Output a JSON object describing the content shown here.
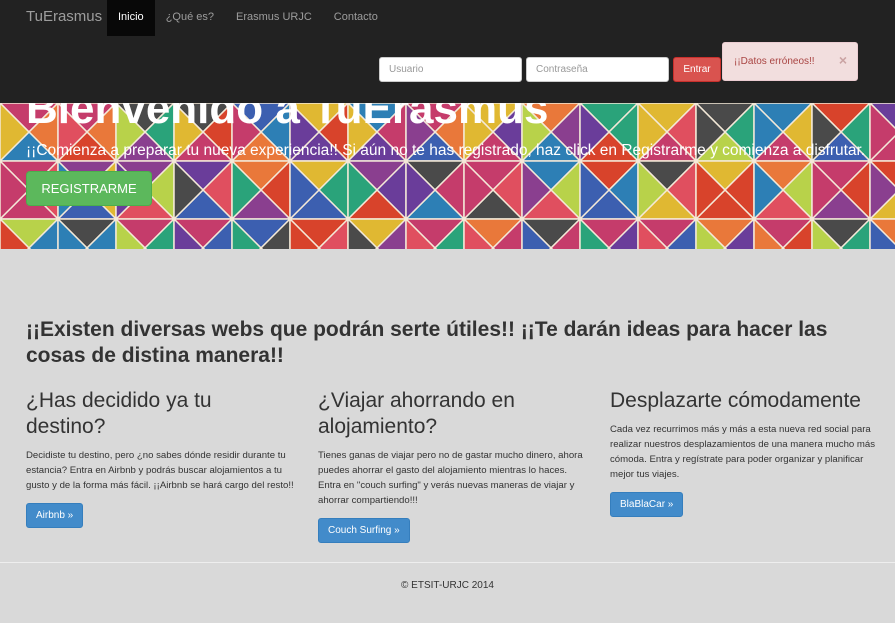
{
  "navbar": {
    "brand": "TuErasmus",
    "items": [
      {
        "label": "Inicio",
        "active": true
      },
      {
        "label": "¿Qué es?",
        "active": false
      },
      {
        "label": "Erasmus URJC",
        "active": false
      },
      {
        "label": "Contacto",
        "active": false
      }
    ],
    "login": {
      "user_placeholder": "Usuario",
      "password_placeholder": "Contraseña",
      "submit_label": "Entrar"
    },
    "alert": {
      "message": "¡¡Datos erróneos!!",
      "close": "×"
    }
  },
  "hero": {
    "title": "Bienvenido a TuErasmus",
    "subtitle": "¡¡Comienza a preparar tu nueva experiencia!! Si aún no te has registrado, haz click en Registrarme y comienza a disfrutar.",
    "register_label": "REGISTRARME"
  },
  "main": {
    "heading": "¡¡Existen diversas webs que podrán serte útiles!! ¡¡Te darán ideas para hacer las cosas de distina manera!!",
    "columns": [
      {
        "title": "¿Has decidido ya tu destino?",
        "text": "Decidiste tu destino, pero ¿no sabes dónde residir durante tu estancia? Entra en Airbnb y podrás buscar alojamientos a tu gusto y de la forma más fácil. ¡¡Airbnb se hará cargo del resto!!",
        "button": "Airbnb »"
      },
      {
        "title": "¿Viajar ahorrando en alojamiento?",
        "text": "Tienes ganas de viajar pero no de gastar mucho dinero, ahora puedes ahorrar el gasto del alojamiento mientras lo haces. Entra en \"couch surfing\" y verás nuevas maneras de viajar y ahorrar compartiendo!!!",
        "button": "Couch Surfing »"
      },
      {
        "title": "Desplazarte cómodamente",
        "text": "Cada vez recurrimos más y más a esta nueva red social para realizar nuestros desplazamientos de una manera mucho más cómoda. Entra y regístrate para poder organizar y planificar mejor tus viajes.",
        "button": "BlaBlaCar »"
      }
    ]
  },
  "footer": {
    "text": "© ETSIT-URJC 2014"
  },
  "colors": {
    "navbar_bg": "#222222",
    "danger": "#d9534f",
    "success": "#5cb85c",
    "primary": "#428bca",
    "page_bg": "#d9d9d9"
  }
}
